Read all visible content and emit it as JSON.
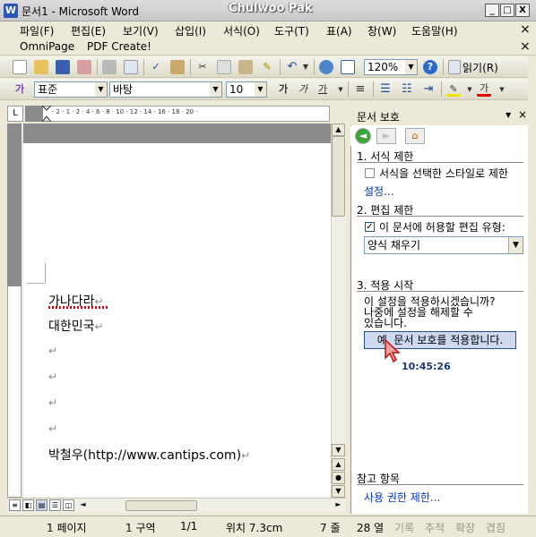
{
  "window": {
    "app_icon_text": "W",
    "title": "문서1 - Microsoft Word",
    "user_overlay": "Chulwoo Pak",
    "minimize": "_",
    "maximize": "□",
    "close": "X"
  },
  "menu": {
    "items": [
      "파일(F)",
      "편집(E)",
      "보기(V)",
      "삽입(I)",
      "서식(O)",
      "도구(T)",
      "표(A)",
      "창(W)",
      "도움말(H)"
    ],
    "close": "×"
  },
  "menu2": {
    "items": [
      "OmniPage",
      "PDF Create!"
    ],
    "close": "×"
  },
  "toolbar_standard": {
    "zoom": "120%",
    "read_label": "읽기(R)"
  },
  "toolbar_format": {
    "style_icon": "가",
    "style": "표준",
    "font": "바탕",
    "size": "10",
    "bold": "가",
    "italic": "가",
    "underline": "가",
    "font_color_label": "가"
  },
  "ruler": {
    "tab_selector": "L",
    "numbers": "· 2 · 1 · 2 · 4 · 6 · 8 · 10 · 12 · 14 · 16 · 18 · 20 ·"
  },
  "document": {
    "lines": [
      "가나다라",
      "대한민국",
      "",
      "",
      "",
      "",
      "박철우(http://www.cantips.com)"
    ],
    "para_mark": "↵"
  },
  "task_pane": {
    "title": "문서 보호",
    "section1_title": "1. 서식 제한",
    "section1_checkbox_label": "서식을 선택한 스타일로 제한",
    "section1_checked": false,
    "section1_link": "설정...",
    "section2_title": "2. 편집 제한",
    "section2_checkbox_label": "이 문서에 허용할 편집 유형:",
    "section2_checked": true,
    "edit_type": "양식 채우기",
    "section3_title": "3. 적용 시작",
    "section3_text1": "이 설정을 적용하시겠습니까?",
    "section3_text2": "나중에 설정을 해제할 수",
    "section3_text3": "있습니다.",
    "apply_button": "예, 문서 보호를 적용합니다.",
    "clock": "10:45:26",
    "reference_title": "참고 항목",
    "reference_link": "사용 권한 제한..."
  },
  "status_bar": {
    "page": "1 페이지",
    "section": "1 구역",
    "page_of": "1/1",
    "position": "위치 7.3cm",
    "line": "7 줄",
    "column": "28 열",
    "rec": "기록",
    "trk": "추적",
    "ext": "확장",
    "ovr": "겹침"
  }
}
